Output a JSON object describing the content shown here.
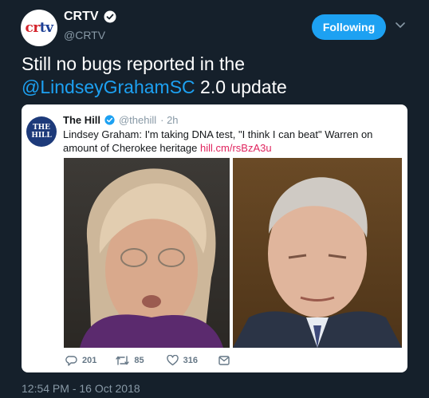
{
  "account": {
    "avatar_text_a": "cr",
    "avatar_text_b": "tv",
    "name": "CRTV",
    "handle": "@CRTV",
    "follow_label": "Following"
  },
  "tweet": {
    "text_before": "Still no bugs reported in the",
    "mention": "@LindseyGrahamSC",
    "text_after": " 2.0 update",
    "timestamp": "12:54 PM - 16 Oct 2018"
  },
  "quote": {
    "logo_line1": "THE",
    "logo_line2": "HILL",
    "name": "The Hill",
    "handle": "@thehill",
    "time": "· 2h",
    "text": "Lindsey Graham: I'm taking DNA test, \"I think I can beat\" Warren on amount of Cherokee heritage ",
    "link": "hill.cm/rsBzA3u",
    "replies": "201",
    "retweets": "85",
    "likes": "316"
  },
  "colors": {
    "background": "#15202b",
    "accent": "#1da1f2",
    "link_red": "#e0245e",
    "muted": "#8899a6"
  },
  "icons": [
    "verified-badge-icon",
    "chevron-down-icon",
    "reply-icon",
    "retweet-icon",
    "like-icon",
    "message-icon"
  ]
}
